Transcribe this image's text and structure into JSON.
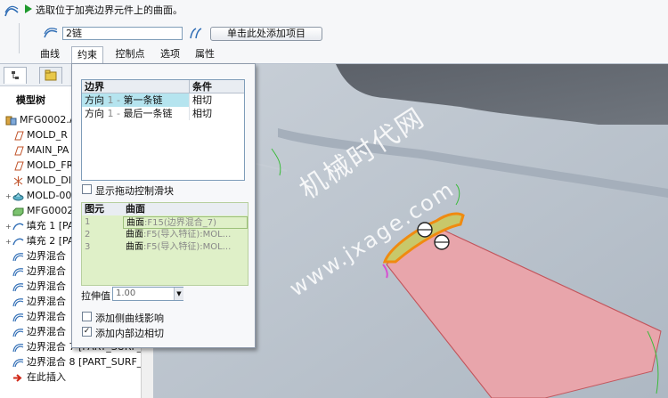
{
  "dashboard": {
    "message": "选取位于加亮边界元件上的曲面。",
    "chain_input_value": "2链",
    "add_item_label": "单击此处添加项目",
    "tabs": [
      "曲线",
      "约束",
      "控制点",
      "选项",
      "属性"
    ]
  },
  "model_tree": {
    "title": "模型树",
    "items": [
      {
        "label": "MFG0002.AS",
        "icon": "assembly-icon"
      },
      {
        "label": "MOLD_R",
        "icon": "datum-plane-icon"
      },
      {
        "label": "MAIN_PA",
        "icon": "datum-plane-icon"
      },
      {
        "label": "MOLD_FR",
        "icon": "datum-plane-icon"
      },
      {
        "label": "MOLD_DI",
        "icon": "coordinate-system-icon"
      },
      {
        "label": "MOLD-00",
        "icon": "component-icon"
      },
      {
        "label": "MFG0002",
        "icon": "workpiece-icon"
      },
      {
        "label": "填充 1 [PA",
        "icon": "fill-surface-icon"
      },
      {
        "label": "填充 2 [PA",
        "icon": "fill-surface-icon"
      },
      {
        "label": "边界混合",
        "icon": "boundary-blend-icon"
      },
      {
        "label": "边界混合",
        "icon": "boundary-blend-icon"
      },
      {
        "label": "边界混合",
        "icon": "boundary-blend-icon"
      },
      {
        "label": "边界混合",
        "icon": "boundary-blend-icon"
      },
      {
        "label": "边界混合",
        "icon": "boundary-blend-icon"
      },
      {
        "label": "边界混合",
        "icon": "boundary-blend-icon"
      },
      {
        "label": "边界混合 7 [PART_SURF_3",
        "icon": "boundary-blend-icon"
      },
      {
        "label": "边界混合 8 [PART_SURF_3",
        "icon": "boundary-blend-icon"
      },
      {
        "label": "在此插入",
        "icon": "insert-here-icon"
      }
    ]
  },
  "constraint_panel": {
    "boundary_header": "边界",
    "condition_header": "条件",
    "rows": [
      {
        "direction": "方向",
        "index": "1",
        "dash": "-",
        "chain": "第一条链",
        "condition": "相切"
      },
      {
        "direction": "方向",
        "index": "1",
        "dash": "-",
        "chain": "最后一条链",
        "condition": "相切"
      }
    ],
    "show_drag_handles": {
      "label": "显示拖动控制滑块",
      "checked": false
    },
    "element_header": "图元",
    "surface_header": "曲面",
    "elements": [
      {
        "num": "1",
        "surface": "曲面",
        "ref": ":F15(边界混合_7)"
      },
      {
        "num": "2",
        "surface": "曲面",
        "ref": ":F5(导入特征):MOL..."
      },
      {
        "num": "3",
        "surface": "曲面",
        "ref": ":F5(导入特征):MOL..."
      }
    ],
    "stretch_label": "拉伸值",
    "stretch_value": "1.00",
    "add_side_curve": {
      "label": "添加侧曲线影响",
      "checked": false
    },
    "add_inner_edge": {
      "label": "添加内部边相切",
      "checked": true
    }
  },
  "viewport": {
    "watermark_1": "机械时代网",
    "watermark_2": "www.jxage.com"
  },
  "colors": {
    "highlight_row": "#b5e4ef",
    "element_table_bg": "#dff0c8",
    "surface_pink": "#e8a5ab",
    "edge_orange": "#f08a10",
    "viewport_bg": "#b8c1cb"
  }
}
